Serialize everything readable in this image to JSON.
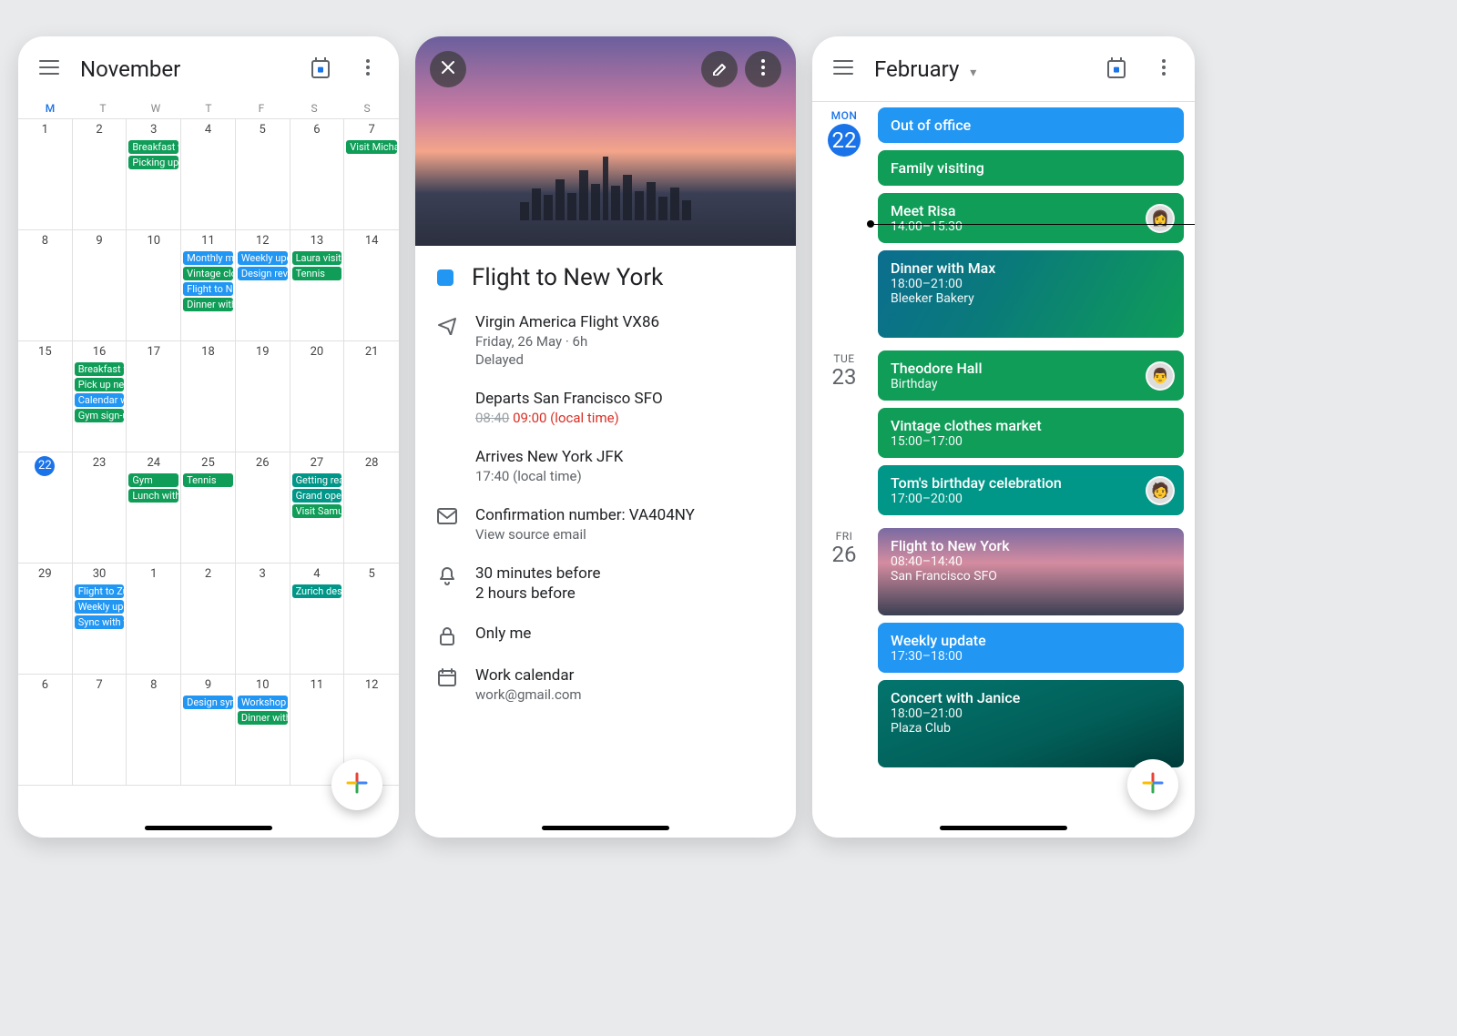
{
  "phone1": {
    "title": "November",
    "dow": [
      "M",
      "T",
      "W",
      "T",
      "F",
      "S",
      "S"
    ],
    "weeks": [
      [
        {
          "n": "1"
        },
        {
          "n": "2"
        },
        {
          "n": "3",
          "items": [
            {
              "t": "Breakfast w",
              "c": "green"
            },
            {
              "t": "Picking up",
              "c": "green"
            }
          ]
        },
        {
          "n": "4"
        },
        {
          "n": "5"
        },
        {
          "n": "6"
        },
        {
          "n": "7",
          "items": [
            {
              "t": "Visit Micha",
              "c": "green"
            }
          ]
        }
      ],
      [
        {
          "n": "8"
        },
        {
          "n": "9"
        },
        {
          "n": "10"
        },
        {
          "n": "11",
          "items": [
            {
              "t": "Monthly me",
              "c": "blue"
            },
            {
              "t": "Vintage clo",
              "c": "green"
            },
            {
              "t": "Flight to Ne",
              "c": "blue"
            },
            {
              "t": "Dinner with",
              "c": "green"
            }
          ]
        },
        {
          "n": "12",
          "items": [
            {
              "t": "Weekly upd",
              "c": "blue"
            },
            {
              "t": "Design revi",
              "c": "blue"
            }
          ]
        },
        {
          "n": "13",
          "items": [
            {
              "t": "Laura visiti",
              "c": "green"
            },
            {
              "t": "Tennis",
              "c": "green"
            }
          ]
        },
        {
          "n": "14"
        }
      ],
      [
        {
          "n": "15"
        },
        {
          "n": "16",
          "items": [
            {
              "t": "Breakfast w",
              "c": "green"
            },
            {
              "t": "Pick up new",
              "c": "green"
            },
            {
              "t": "Calendar w",
              "c": "blue"
            },
            {
              "t": "Gym sign-u",
              "c": "green"
            }
          ]
        },
        {
          "n": "17"
        },
        {
          "n": "18"
        },
        {
          "n": "19"
        },
        {
          "n": "20"
        },
        {
          "n": "21"
        }
      ],
      [
        {
          "n": "22",
          "today": true
        },
        {
          "n": "23"
        },
        {
          "n": "24",
          "items": [
            {
              "t": "Gym",
              "c": "green"
            },
            {
              "t": "Lunch with",
              "c": "green"
            }
          ]
        },
        {
          "n": "25",
          "items": [
            {
              "t": "Tennis",
              "c": "green"
            }
          ]
        },
        {
          "n": "26"
        },
        {
          "n": "27",
          "items": [
            {
              "t": "Getting rea",
              "c": "teal"
            },
            {
              "t": "Grand open",
              "c": "teal"
            },
            {
              "t": "Visit Samue",
              "c": "green"
            }
          ]
        },
        {
          "n": "28"
        }
      ],
      [
        {
          "n": "29"
        },
        {
          "n": "30",
          "items": [
            {
              "t": "Flight to Zu",
              "c": "blue"
            },
            {
              "t": "Weekly upd",
              "c": "blue"
            },
            {
              "t": "Sync with t",
              "c": "blue"
            }
          ]
        },
        {
          "n": "1"
        },
        {
          "n": "2"
        },
        {
          "n": "3"
        },
        {
          "n": "4",
          "items": [
            {
              "t": "Zurich desi",
              "c": "teal"
            }
          ]
        },
        {
          "n": "5"
        }
      ],
      [
        {
          "n": "6"
        },
        {
          "n": "7"
        },
        {
          "n": "8"
        },
        {
          "n": "9",
          "items": [
            {
              "t": "Design syn",
              "c": "blue"
            }
          ]
        },
        {
          "n": "10",
          "items": [
            {
              "t": "Workshop",
              "c": "blue"
            },
            {
              "t": "Dinner with",
              "c": "green"
            }
          ]
        },
        {
          "n": "11"
        },
        {
          "n": "12"
        }
      ]
    ]
  },
  "phone2": {
    "title": "Flight to New York",
    "flight": {
      "airline": "Virgin America Flight VX86",
      "date": "Friday, 26 May  ·  6h",
      "status": "Delayed"
    },
    "depart": {
      "label": "Departs San Francisco SFO",
      "old_time": "08:40",
      "new_time": "09:00 (local time)"
    },
    "arrive": {
      "label": "Arrives New York JFK",
      "time": "17:40 (local time)"
    },
    "confirmation": {
      "label": "Confirmation number: VA404NY",
      "link": "View source email"
    },
    "reminders": [
      "30 minutes before",
      "2 hours before"
    ],
    "visibility": "Only me",
    "calendar": {
      "name": "Work calendar",
      "email": "work@gmail.com"
    }
  },
  "phone3": {
    "title": "February",
    "days": [
      {
        "dow": "MON",
        "num": "22",
        "today": true,
        "cards": [
          {
            "title": "Out of office",
            "cls": "c1-blue"
          },
          {
            "title": "Family visiting",
            "cls": "c1-green"
          },
          {
            "title": "Meet Risa",
            "sub": "14:00–15:30",
            "cls": "c1-green",
            "avatar": "👩"
          },
          {
            "title": "Dinner with Max",
            "sub": "18:00–21:00",
            "sub2": "Bleeker Bakery",
            "cls": "img-dinner"
          }
        ]
      },
      {
        "dow": "TUE",
        "num": "23",
        "cards": [
          {
            "title": "Theodore Hall",
            "sub": "Birthday",
            "cls": "c1-green",
            "avatar": "👨"
          },
          {
            "title": "Vintage clothes market",
            "sub": "15:00–17:00",
            "cls": "c1-green"
          },
          {
            "title": "Tom's birthday celebration",
            "sub": "17:00–20:00",
            "cls": "c1-teal",
            "avatar": "🧑"
          }
        ]
      },
      {
        "dow": "FRI",
        "num": "26",
        "cards": [
          {
            "title": "Flight to New York",
            "sub": "08:40–14:40",
            "sub2": "San Francisco SFO",
            "cls": "img-ny"
          },
          {
            "title": "Weekly update",
            "sub": "17:30–18:00",
            "cls": "c1-blue"
          },
          {
            "title": "Concert with Janice",
            "sub": "18:00–21:00",
            "sub2": "Plaza Club",
            "cls": "img-concert"
          }
        ]
      }
    ]
  }
}
